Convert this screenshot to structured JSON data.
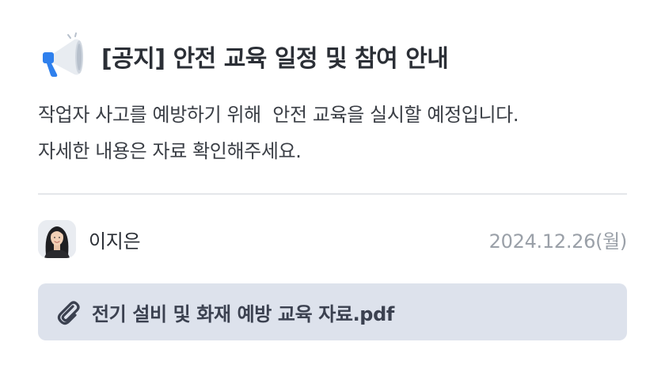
{
  "notice": {
    "icon": "megaphone-icon",
    "title": "[공지] 안전 교육 일정 및 참여 안내",
    "body_lines": [
      "작업자 사고를 예방하기 위해  안전 교육을 실시할 예정입니다.",
      "자세한 내용은 자료 확인해주세요."
    ]
  },
  "author": {
    "avatar_icon": "avatar",
    "name": "이지은",
    "date": "2024.12.26(월)"
  },
  "attachment": {
    "icon": "paperclip-icon",
    "filename": "전기 설비 및 화재 예방 교육 자료.pdf"
  },
  "colors": {
    "title": "#2b2f36",
    "date": "#9aa0a8",
    "attachment_bg": "#dde2ec",
    "accent_blue": "#2f80ed"
  }
}
